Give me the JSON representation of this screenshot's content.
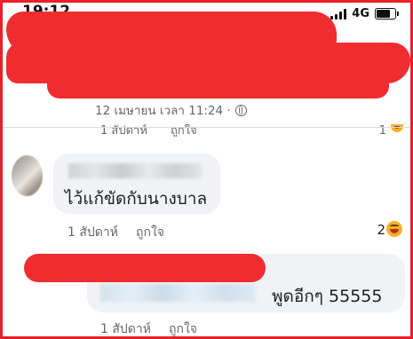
{
  "status_bar": {
    "time": "19:12",
    "network": "4G"
  },
  "post": {
    "timestamp": "12 เมษายน เวลา 11:24 ·"
  },
  "prev_comment": {
    "time": "1 สัปดาห์",
    "like": "ถูกใจ",
    "reaction_count": "1"
  },
  "comment1": {
    "text": "ไว้แก้ขัดกับนางบาล",
    "time": "1 สัปดาห์",
    "like": "ถูกใจ",
    "reaction_count": "2",
    "reaction_icon": "haha-icon"
  },
  "comment2": {
    "text": "พูดอีกๆ 55555",
    "time": "1 สัปดาห์",
    "like": "ถูกใจ"
  },
  "colors": {
    "redaction": "#ef2c2f",
    "frame": "#e8202a",
    "bubble": "#f0f2f5",
    "meta_text": "#65676b"
  }
}
